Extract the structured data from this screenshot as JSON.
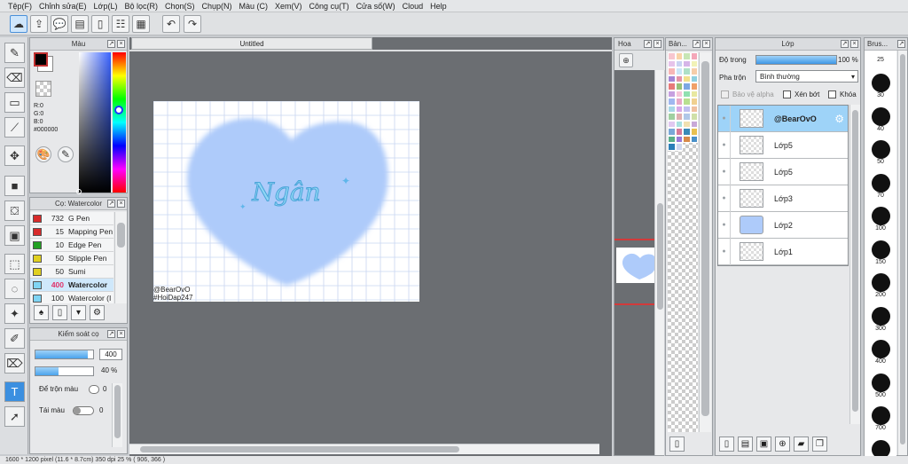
{
  "menu": [
    "Tệp(F)",
    "Chỉnh sửa(E)",
    "Lớp(L)",
    "Bộ lọc(R)",
    "Chọn(S)",
    "Chụp(N)",
    "Màu (C)",
    "Xem(V)",
    "Công cụ(T)",
    "Cửa số(W)",
    "Cloud",
    "Help"
  ],
  "toolbar_icons": [
    "cloud-icon",
    "share-icon",
    "comment-icon",
    "chat-icon",
    "page-icon",
    "gallery-icon",
    "grid-icon",
    "undo-icon",
    "redo-icon"
  ],
  "color_panel": {
    "title": "Màu",
    "r": "R:0",
    "g": "G:0",
    "b": "B:0",
    "hex": "#000000",
    "fg": "#000000",
    "bg": "#ffffff"
  },
  "brush_panel": {
    "title": "Cọ: Watercolor",
    "items": [
      {
        "color": "#d82b2b",
        "size": "732",
        "name": "G Pen"
      },
      {
        "color": "#d82b2b",
        "size": "15",
        "name": "Mapping Pen"
      },
      {
        "color": "#22a022",
        "size": "10",
        "name": "Edge Pen"
      },
      {
        "color": "#e0d020",
        "size": "50",
        "name": "Stipple Pen"
      },
      {
        "color": "#e0d020",
        "size": "50",
        "name": "Sumi"
      },
      {
        "color": "#7fd4f4",
        "size": "400",
        "name": "Watercolor",
        "selected": true
      },
      {
        "color": "#7fd4f4",
        "size": "100",
        "name": "Watercolor (I"
      }
    ]
  },
  "brush_control": {
    "title": "Kiểm soát cọ",
    "size_value": "400",
    "opacity_value": "40 %",
    "size_fraction": 0.9,
    "opacity_fraction": 0.4,
    "blend_label": "Để trộn màu",
    "blend_value": "0",
    "recolor_label": "Tái màu",
    "recolor_value": "0"
  },
  "canvas": {
    "tab_title": "Untitled",
    "heart_text": "Ngân",
    "watermark_1": "@BearOvO",
    "watermark_2": "#HoiDap247",
    "grid_color": "#c8d6f0",
    "heart_color": "#aecbfa"
  },
  "navigator_title": "Hoa",
  "palette_title": "Bản...",
  "palette_colors": [
    "#f7c6cf",
    "#f9d3a9",
    "#c7e6b5",
    "#f4a7b9",
    "#e6c3ea",
    "#c9d3f2",
    "#d6b5e8",
    "#f1f2b6",
    "#f7b6b6",
    "#cbe7f8",
    "#aee0c7",
    "#f6cda9",
    "#a487d6",
    "#e493a8",
    "#f2e08c",
    "#8fd0e0",
    "#e77a7a",
    "#98c07a",
    "#7da7e3",
    "#f0a068",
    "#c6a0e0",
    "#f5c5d9",
    "#90e0b0",
    "#e8e8a0",
    "#a0b8f0",
    "#e8a8c8",
    "#b8e090",
    "#f0d090",
    "#a8d8e8",
    "#d8a8e8",
    "#c0c0f0",
    "#f0c0a0",
    "#a0d0a0",
    "#e0b0b0",
    "#b0c8e8",
    "#d0e0a8",
    "#e0c8f0",
    "#a8e0e0",
    "#f0e0b0",
    "#c8a8d8",
    "#7aa8d8",
    "#d87a9a",
    "#3a8ab8",
    "#e8c050",
    "#5ab08a",
    "#9a7ad8",
    "#d88a4a",
    "#4a90c8",
    "#2b7fb8",
    "#cfd8f0"
  ],
  "layer_panel": {
    "title": "Lớp",
    "opacity_label": "Độ trong",
    "opacity_value": "100 %",
    "opacity_fraction": 1.0,
    "blend_label": "Pha trộn",
    "blend_value": "Bình thường",
    "protect_alpha": "Bảo vệ alpha",
    "clipping": "Xén bớt",
    "lock": "Khóa",
    "layers": [
      {
        "name": "@BearOvO",
        "selected": true
      },
      {
        "name": "Lớp5"
      },
      {
        "name": "Lớp5"
      },
      {
        "name": "Lớp3"
      },
      {
        "name": "Lớp2"
      },
      {
        "name": "Lớp1"
      }
    ]
  },
  "brush_size_panel": {
    "title": "Brus...",
    "sizes": [
      "25",
      "30",
      "40",
      "50",
      "70",
      "100",
      "150",
      "200",
      "300",
      "400",
      "500",
      "700",
      "1000"
    ]
  },
  "status": "1600 * 1200 pixel   (11.6 * 8.7cm)   350 dpi   25 %   ( 906, 366 )"
}
